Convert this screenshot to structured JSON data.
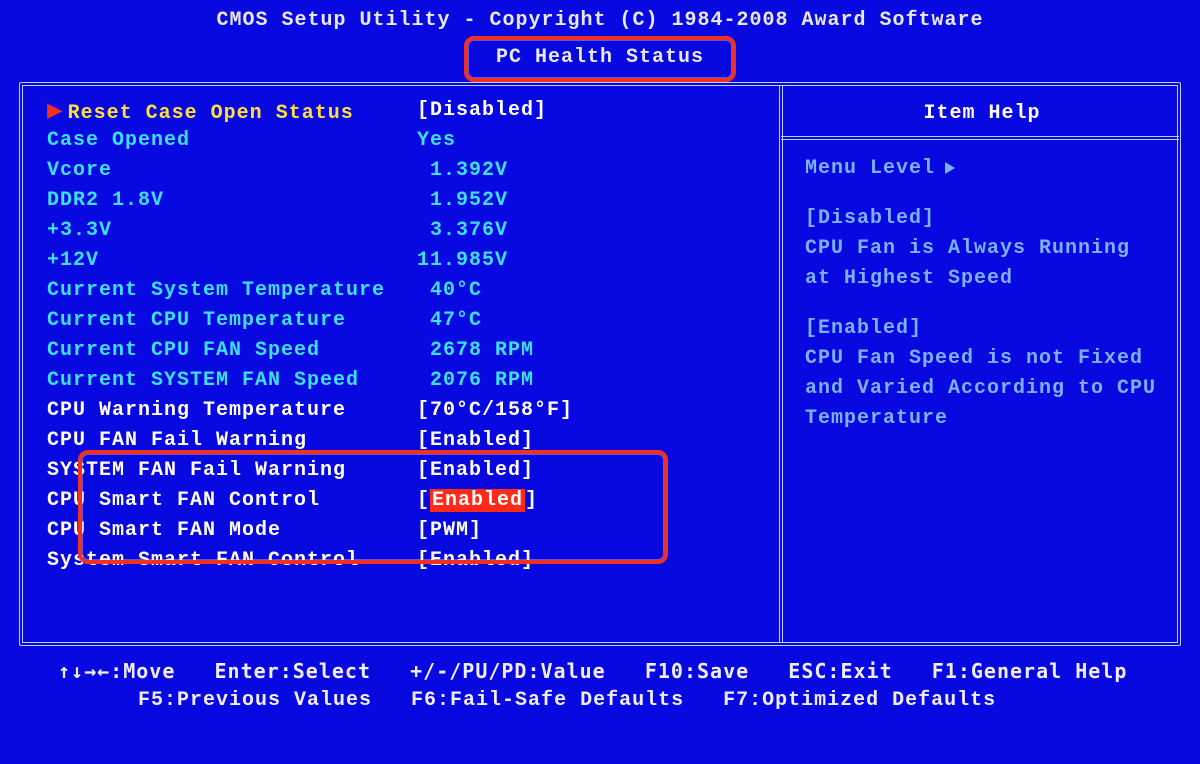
{
  "header": {
    "copyright": "CMOS Setup Utility - Copyright (C) 1984-2008 Award Software",
    "page_title": "PC Health Status"
  },
  "settings": [
    {
      "label": "Reset Case Open Status",
      "value": "Disabled",
      "label_color": "yellow",
      "val_color": "white",
      "bracket": true,
      "interact": true,
      "caret": true
    },
    {
      "label": "Case Opened",
      "value": "Yes",
      "label_color": "cyan",
      "val_color": "cyan",
      "bracket": false,
      "interact": false,
      "caret": false
    },
    {
      "label": "Vcore",
      "value": " 1.392V",
      "label_color": "cyan",
      "val_color": "cyan",
      "bracket": false,
      "interact": false,
      "caret": false
    },
    {
      "label": "DDR2 1.8V",
      "value": " 1.952V",
      "label_color": "cyan",
      "val_color": "cyan",
      "bracket": false,
      "interact": false,
      "caret": false
    },
    {
      "label": "+3.3V",
      "value": " 3.376V",
      "label_color": "cyan",
      "val_color": "cyan",
      "bracket": false,
      "interact": false,
      "caret": false
    },
    {
      "label": "+12V",
      "value": "11.985V",
      "label_color": "cyan",
      "val_color": "cyan",
      "bracket": false,
      "interact": false,
      "caret": false
    },
    {
      "label": "Current System Temperature",
      "value": " 40°C",
      "label_color": "cyan",
      "val_color": "cyan",
      "bracket": false,
      "interact": false,
      "caret": false
    },
    {
      "label": "Current CPU Temperature",
      "value": " 47°C",
      "label_color": "cyan",
      "val_color": "cyan",
      "bracket": false,
      "interact": false,
      "caret": false
    },
    {
      "label": "Current CPU FAN Speed",
      "value": " 2678 RPM",
      "label_color": "cyan",
      "val_color": "cyan",
      "bracket": false,
      "interact": false,
      "caret": false
    },
    {
      "label": "Current SYSTEM FAN Speed",
      "value": " 2076 RPM",
      "label_color": "cyan",
      "val_color": "cyan",
      "bracket": false,
      "interact": false,
      "caret": false
    },
    {
      "label": "CPU Warning Temperature",
      "value": "70°C/158°F",
      "label_color": "white",
      "val_color": "white",
      "bracket": true,
      "interact": true,
      "caret": false
    },
    {
      "label": "CPU FAN Fail Warning",
      "value": "Enabled",
      "label_color": "white",
      "val_color": "white",
      "bracket": true,
      "interact": true,
      "caret": false
    },
    {
      "label": "SYSTEM FAN Fail Warning",
      "value": "Enabled",
      "label_color": "white",
      "val_color": "white",
      "bracket": true,
      "interact": true,
      "caret": false
    },
    {
      "label": "CPU Smart FAN Control",
      "value": "Enabled",
      "label_color": "white",
      "val_color": "white",
      "bracket": true,
      "interact": true,
      "caret": false,
      "highlight": true
    },
    {
      "label": "CPU Smart FAN Mode",
      "value": "PWM",
      "label_color": "white",
      "val_color": "white",
      "bracket": true,
      "interact": true,
      "caret": false
    },
    {
      "label": "System Smart FAN Control",
      "value": "Enabled",
      "label_color": "white",
      "val_color": "white",
      "bracket": true,
      "interact": true,
      "caret": false
    }
  ],
  "help": {
    "title": "Item Help",
    "menu_level": "Menu Level",
    "sections": [
      {
        "head": "[Disabled]",
        "body": "CPU Fan is Always Running at Highest Speed"
      },
      {
        "head": "[Enabled]",
        "body": "CPU Fan Speed is not Fixed and Varied According to CPU Temperature"
      }
    ]
  },
  "footer": {
    "line1": "↑↓→←:Move   Enter:Select   +/-/PU/PD:Value   F10:Save   ESC:Exit   F1:General Help",
    "line2": "F5:Previous Values   F6:Fail-Safe Defaults   F7:Optimized Defaults"
  }
}
